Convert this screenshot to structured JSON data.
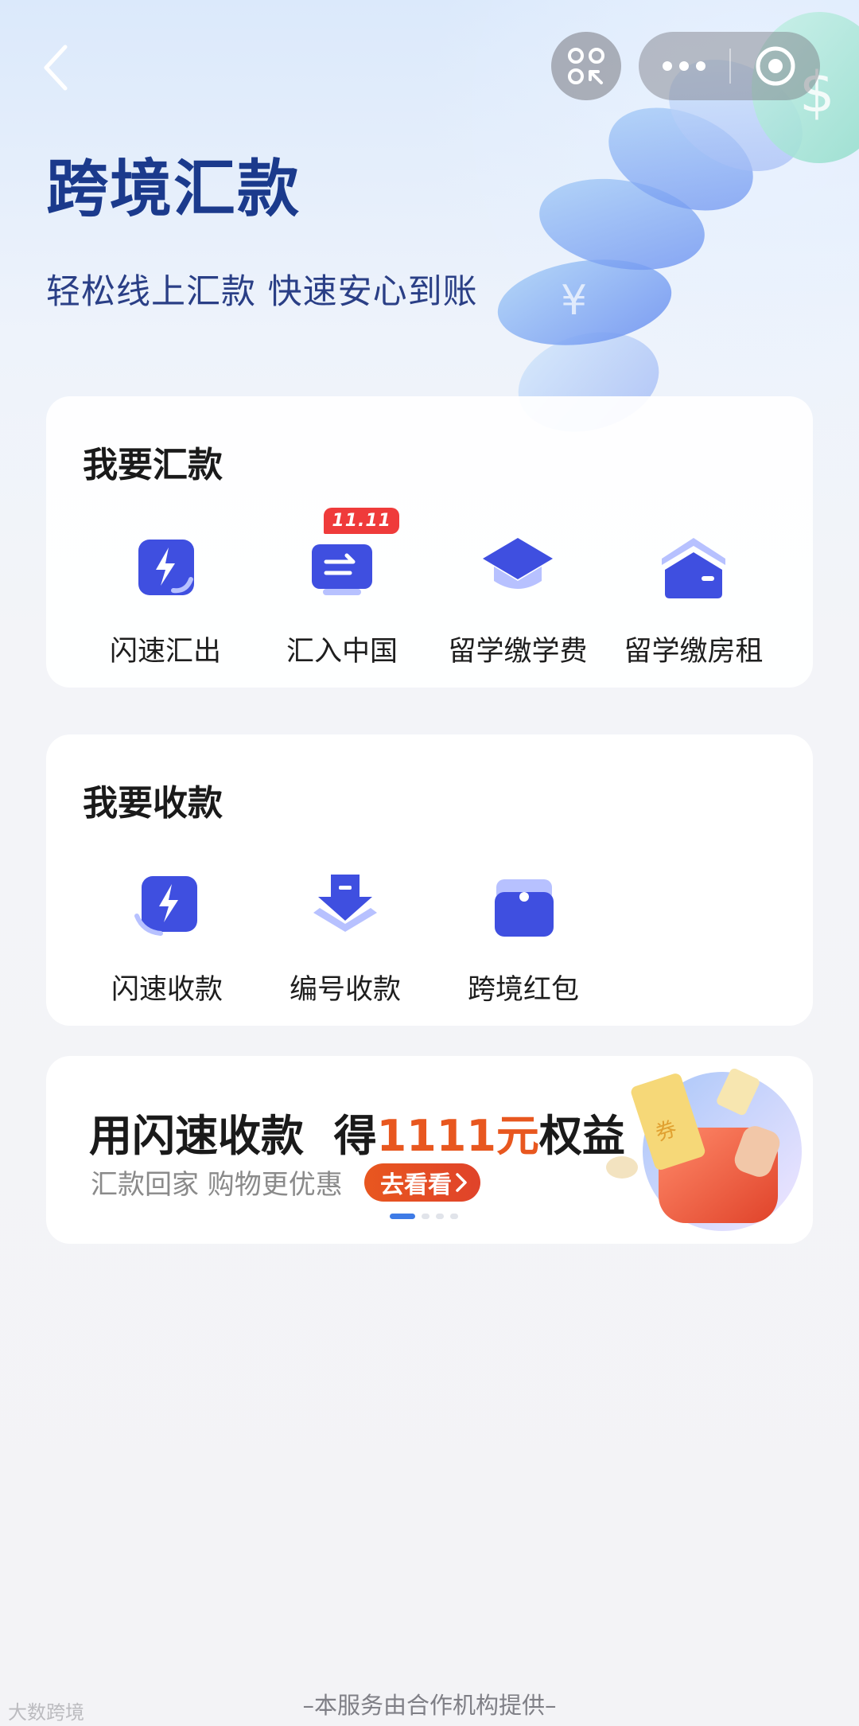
{
  "nav": {
    "back_icon": "chevron-left-icon",
    "scan_icon": "scan-icon",
    "more_icon": "more-dots-icon",
    "close_icon": "target-circle-icon"
  },
  "header": {
    "title": "跨境汇款",
    "subtitle": "轻松线上汇款 快速安心到账"
  },
  "send_section": {
    "title": "我要汇款",
    "items": [
      {
        "label": "闪速汇出",
        "icon": "lightning-card-icon"
      },
      {
        "label": "汇入中国",
        "icon": "transfer-in-icon",
        "badge": "11.11"
      },
      {
        "label": "留学缴学费",
        "icon": "graduation-cap-icon"
      },
      {
        "label": "留学缴房租",
        "icon": "house-icon"
      }
    ]
  },
  "receive_section": {
    "title": "我要收款",
    "items": [
      {
        "label": "闪速收款",
        "icon": "lightning-receive-icon"
      },
      {
        "label": "编号收款",
        "icon": "download-tray-icon"
      },
      {
        "label": "跨境红包",
        "icon": "red-packet-icon"
      }
    ]
  },
  "banner": {
    "headline_prefix": "用闪速收款  得",
    "headline_amount": "1111元",
    "headline_suffix": "权益",
    "sub": "汇款回家 购物更优惠",
    "cta": "去看看",
    "cta_icon": "chevron-right-icon",
    "illustration": "gift-coupon-illustration",
    "page_total": 4,
    "page_active": 1
  },
  "footer": {
    "text": "–本服务由合作机构提供–",
    "watermark": "大数跨境"
  },
  "colors": {
    "primary": "#3f4fe0",
    "title": "#1b3a8c",
    "accent": "#e8571f",
    "badge": "#ef3b3b"
  }
}
